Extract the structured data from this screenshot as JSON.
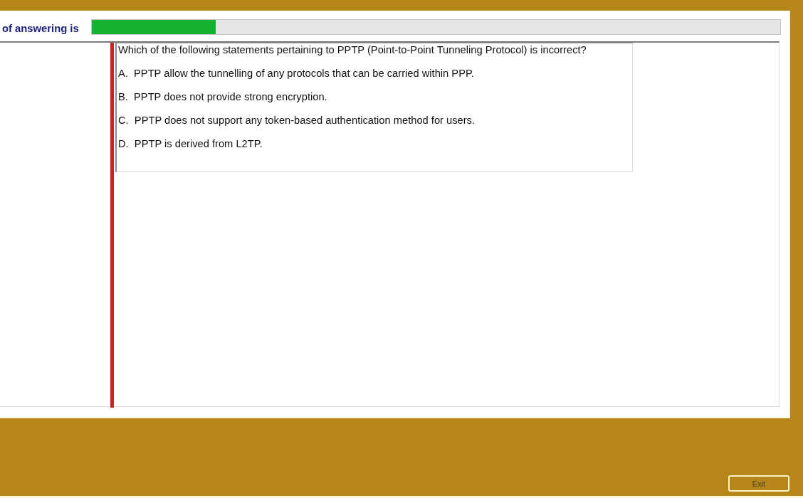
{
  "progress": {
    "label": "of answering is",
    "level": 0.18
  },
  "question": {
    "text": "Which of the following statements pertaining to PPTP (Point-to-Point Tunneling Protocol) is incorrect?",
    "options": [
      {
        "letter": "A.",
        "text": "PPTP allow the tunnelling of any protocols that can be carried within PPP."
      },
      {
        "letter": "B.",
        "text": "PPTP does not provide strong encryption."
      },
      {
        "letter": "C.",
        "text": "PPTP does not support any token-based authentication method for users."
      },
      {
        "letter": "D.",
        "text": "PPTP is derived from L2TP."
      }
    ]
  },
  "exit_button": {
    "label": "Exit"
  }
}
